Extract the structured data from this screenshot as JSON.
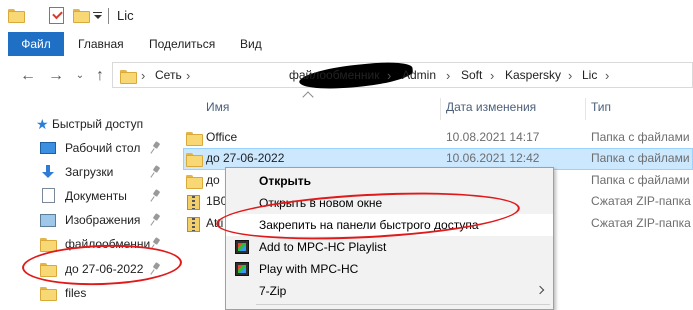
{
  "window": {
    "title": "Lic"
  },
  "ribbon": {
    "tabs": [
      "Файл",
      "Главная",
      "Поделиться",
      "Вид"
    ]
  },
  "address": {
    "crumbs": [
      "Сеть",
      "файлообменник",
      "Admin",
      "Soft",
      "Kaspersky",
      "Lic"
    ]
  },
  "columns": {
    "name": "Имя",
    "date": "Дата изменения",
    "type": "Тип"
  },
  "sidebar": {
    "quick_access": "Быстрый доступ",
    "items": [
      {
        "label": "Рабочий стол",
        "icon": "desktop-icon",
        "pinned": true
      },
      {
        "label": "Загрузки",
        "icon": "downloads-icon",
        "pinned": true
      },
      {
        "label": "Документы",
        "icon": "documents-icon",
        "pinned": true
      },
      {
        "label": "Изображения",
        "icon": "pictures-icon",
        "pinned": true
      },
      {
        "label": "файлообменни",
        "icon": "folder-icon",
        "pinned": true
      },
      {
        "label": "до 27-06-2022",
        "icon": "folder-icon",
        "pinned": true
      },
      {
        "label": "files",
        "icon": "folder-icon",
        "pinned": false
      }
    ]
  },
  "files": [
    {
      "name": "Office",
      "date": "10.08.2021 14:17",
      "type": "Папка с файлами",
      "icon": "folder-icon",
      "selected": false
    },
    {
      "name": "до 27-06-2022",
      "date": "10.06.2021 12:42",
      "type": "Папка с файлами",
      "icon": "folder-icon",
      "selected": true
    },
    {
      "name": "до",
      "date": "",
      "type": "Папка с файлами",
      "icon": "folder-icon",
      "selected": false
    },
    {
      "name": "1B0",
      "date": "",
      "type": "Сжатая ZIP-папка",
      "icon": "zip-icon",
      "selected": false
    },
    {
      "name": "Atti",
      "date": "",
      "type": "Сжатая ZIP-папка",
      "icon": "zip-icon",
      "selected": false
    }
  ],
  "context_menu": {
    "open": "Открыть",
    "open_new_window": "Открыть в новом окне",
    "pin_quick_access": "Закрепить на панели быстрого доступа",
    "add_mpc_playlist": "Add to MPC-HC Playlist",
    "play_mpc": "Play with MPC-HC",
    "seven_zip": "7-Zip"
  },
  "colors": {
    "accent": "#1f6fc5",
    "selection": "#cce8ff",
    "annotation": "#e01a1a",
    "folder": "#f8d775"
  }
}
